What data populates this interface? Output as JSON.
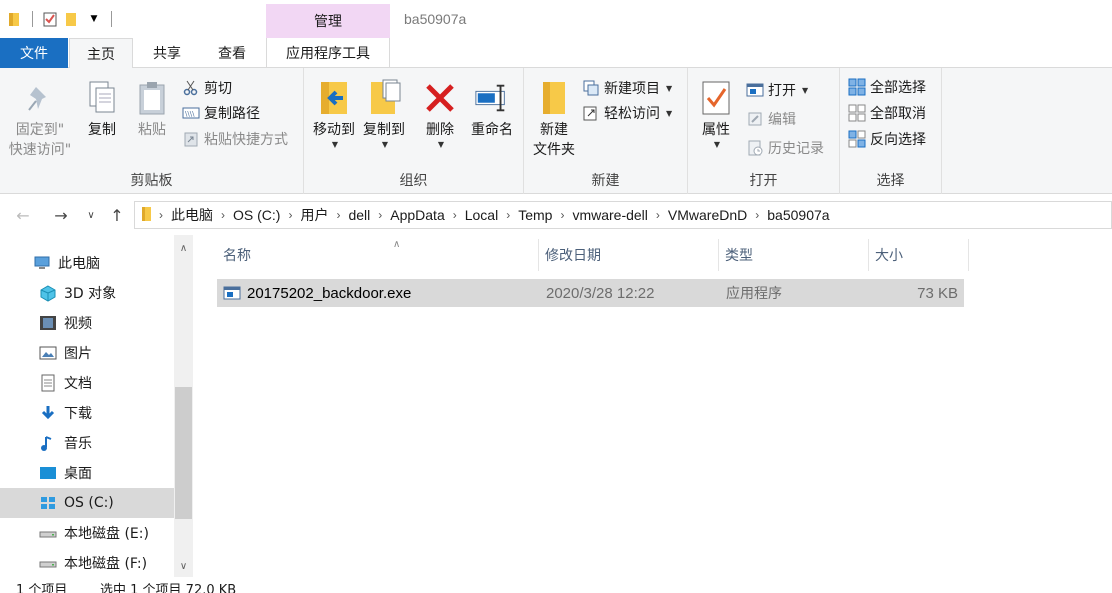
{
  "window": {
    "title": "ba50907a",
    "context_tab_header": "管理"
  },
  "tabs": {
    "file": "文件",
    "home": "主页",
    "share": "共享",
    "view": "查看",
    "app_tools": "应用程序工具"
  },
  "ribbon": {
    "clipboard": {
      "label": "剪贴板",
      "pin_line1": "固定到\"",
      "pin_line2": "快速访问\"",
      "copy": "复制",
      "paste": "粘贴",
      "cut": "剪切",
      "copy_path": "复制路径",
      "paste_shortcut": "粘贴快捷方式"
    },
    "organize": {
      "label": "组织",
      "move_to": "移动到",
      "copy_to": "复制到",
      "delete": "删除",
      "rename": "重命名"
    },
    "new": {
      "label": "新建",
      "new_folder_line1": "新建",
      "new_folder_line2": "文件夹",
      "new_item": "新建项目",
      "easy_access": "轻松访问"
    },
    "open": {
      "label": "打开",
      "properties": "属性",
      "open": "打开",
      "edit": "编辑",
      "history": "历史记录"
    },
    "select": {
      "label": "选择",
      "select_all": "全部选择",
      "select_none": "全部取消",
      "invert": "反向选择"
    }
  },
  "address": {
    "crumbs": [
      "此电脑",
      "OS (C:)",
      "用户",
      "dell",
      "AppData",
      "Local",
      "Temp",
      "vmware-dell",
      "VMwareDnD",
      "ba50907a"
    ]
  },
  "nav_pane": {
    "items": [
      {
        "label": "此电脑",
        "icon": "computer-icon"
      },
      {
        "label": "3D 对象",
        "icon": "3d-objects-icon"
      },
      {
        "label": "视频",
        "icon": "video-icon"
      },
      {
        "label": "图片",
        "icon": "pictures-icon"
      },
      {
        "label": "文档",
        "icon": "documents-icon"
      },
      {
        "label": "下载",
        "icon": "download-icon"
      },
      {
        "label": "音乐",
        "icon": "music-icon"
      },
      {
        "label": "桌面",
        "icon": "desktop-icon"
      },
      {
        "label": "OS (C:)",
        "icon": "os-drive-icon"
      },
      {
        "label": "本地磁盘 (E:)",
        "icon": "disk-icon"
      },
      {
        "label": "本地磁盘 (F:)",
        "icon": "disk-icon"
      }
    ]
  },
  "file_list": {
    "columns": {
      "name": "名称",
      "modified": "修改日期",
      "type": "类型",
      "size": "大小"
    },
    "rows": [
      {
        "name": "20175202_backdoor.exe",
        "modified": "2020/3/28 12:22",
        "type": "应用程序",
        "size": "73 KB"
      }
    ]
  },
  "status": {
    "count": "1 个项目",
    "selected": "选中 1 个项目 72.0 KB"
  },
  "colors": {
    "accent_blue": "#1a6fc2",
    "context_tab_pink": "#f2d7f4",
    "selection_gray": "#d9d9d9"
  }
}
